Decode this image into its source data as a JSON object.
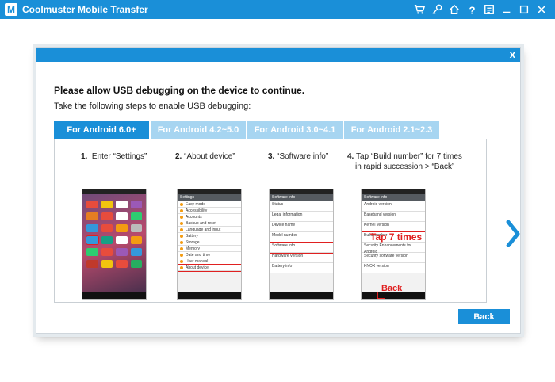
{
  "app": {
    "title": "Coolmuster Mobile Transfer",
    "logo_letter": "M",
    "accent_color": "#1a8fd8",
    "toolbar_icons": [
      "cart-icon",
      "key-icon",
      "home-icon",
      "help-icon",
      "feedback-icon",
      "minimize-icon",
      "maximize-icon",
      "close-icon"
    ]
  },
  "dialog": {
    "close_label": "x",
    "heading": "Please allow USB debugging on the device to continue.",
    "subheading": "Take the following steps to enable USB debugging:",
    "tabs": [
      {
        "label": "For Android 6.0+",
        "active": true
      },
      {
        "label": "For Android 4.2~5.0",
        "active": false
      },
      {
        "label": "For Android 3.0~4.1",
        "active": false
      },
      {
        "label": "For Android 2.1~2.3",
        "active": false
      }
    ],
    "steps": [
      {
        "number": "1.",
        "text": "Enter “Settings”"
      },
      {
        "number": "2.",
        "text": "“About device”"
      },
      {
        "number": "3.",
        "text": "“Software info”"
      },
      {
        "number": "4.",
        "text": "Tap “Build number” for 7 times",
        "text2": "in rapid succession > “Back”"
      }
    ],
    "phone2": {
      "appbar": "Settings",
      "rows": [
        "Easy mode",
        "Accessibility",
        "Accounts",
        "Backup and reset",
        "Language and input",
        "Battery",
        "Storage",
        "Memory",
        "Date and time",
        "User manual",
        "About device"
      ]
    },
    "phone3": {
      "appbar": "Software info",
      "rows": [
        "Status",
        "Legal information",
        "Device name",
        "Model number",
        "Software info",
        "Hardware version",
        "Battery info"
      ]
    },
    "phone4": {
      "appbar": "Software info",
      "rows": [
        "Android version",
        "Baseband version",
        "Kernel version",
        "Build number",
        "Security Enhancements for Android",
        "Security software version",
        "KNOX version"
      ]
    },
    "tap_label": "Tap 7 times",
    "back_label_on_phone": "Back",
    "back_button": "Back"
  }
}
